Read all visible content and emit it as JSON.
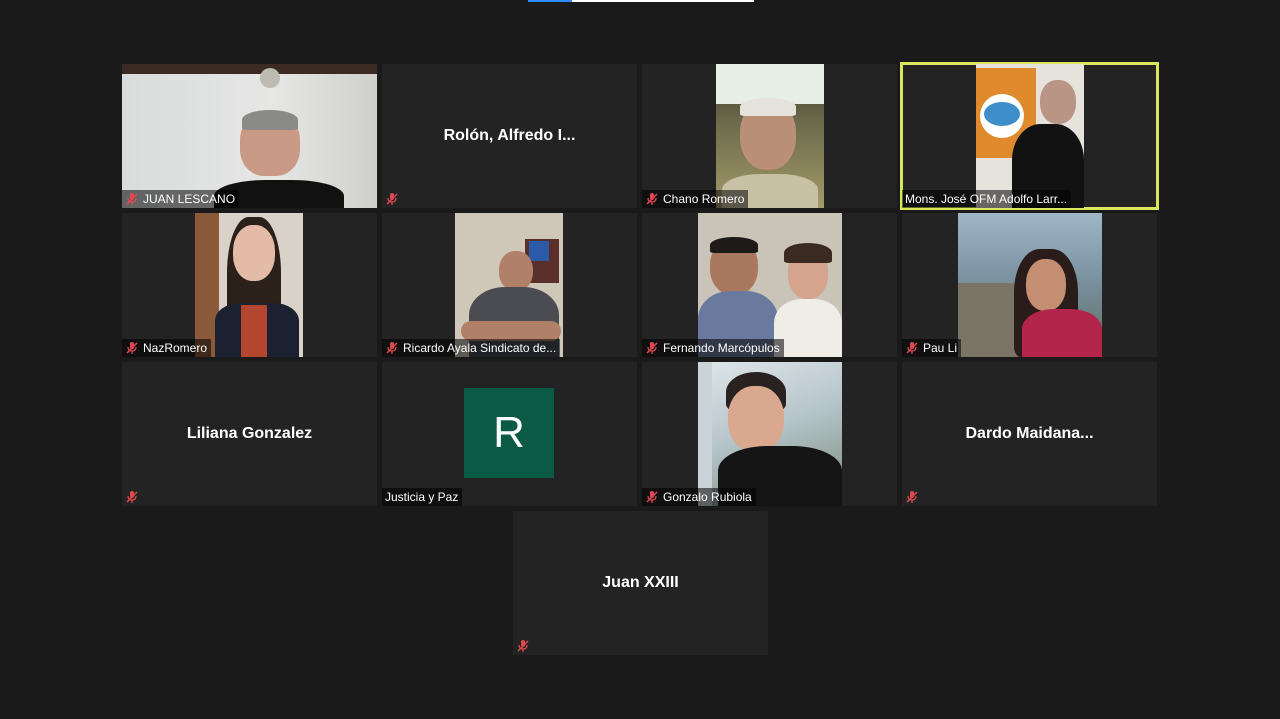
{
  "meeting": {
    "participants": [
      {
        "name": "JUAN LESCANO",
        "muted": true
      },
      {
        "name": "Rolón, Alfredo I...",
        "muted": true
      },
      {
        "name": "Chano Romero",
        "muted": true
      },
      {
        "name": "Mons. José OFM Adolfo Larr...",
        "muted": false,
        "active_speaker": true
      },
      {
        "name": "NazRomero",
        "muted": true
      },
      {
        "name": "Ricardo Ayala Sindicato de...",
        "muted": true
      },
      {
        "name": "Fernando Marcópulos",
        "muted": true
      },
      {
        "name": "Pau Li",
        "muted": true
      },
      {
        "name": "Liliana Gonzalez",
        "muted": true
      },
      {
        "name": "Justicia y Paz",
        "muted": false,
        "avatar_letter": "R"
      },
      {
        "name": "Gonzalo Rubiola",
        "muted": true
      },
      {
        "name": "Dardo Maidana...",
        "muted": true
      },
      {
        "name": "Juan XXIII",
        "muted": true
      }
    ]
  },
  "colors": {
    "background": "#1a1a1a",
    "tile": "#232323",
    "active_speaker_border": "#d8e85a",
    "muted_icon": "#e0484f",
    "avatar_bg": "#0b5a46"
  }
}
